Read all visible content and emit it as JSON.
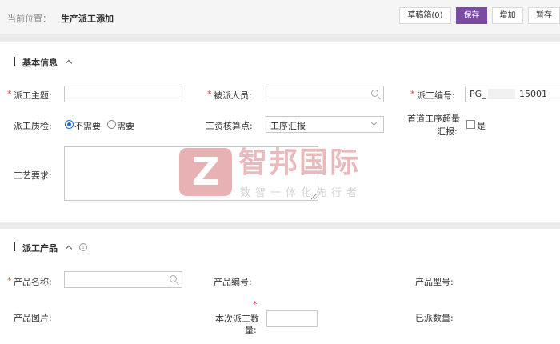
{
  "breadcrumb": {
    "label": "当前位置：",
    "page": "生产派工添加"
  },
  "toolbar": {
    "draft": "草稿箱(0)",
    "save": "保存",
    "add": "增加",
    "hold": "暂存"
  },
  "colors": {
    "accent": "#7b4aa3",
    "required": "#e4393c",
    "radio_selected": "#1f6fd0"
  },
  "basic": {
    "title": "基本信息",
    "subject_label": "派工主题:",
    "assignee_label": "被派人员:",
    "number_label": "派工编号:",
    "number_value_prefix": "PG_",
    "number_value_suffix": "15001",
    "qc_label": "派工质检:",
    "qc_opt_no": "不需要",
    "qc_opt_yes": "需要",
    "qc_selected": "不需要",
    "wage_label": "工资核算点:",
    "wage_value": "工序汇报",
    "first_over_label_1": "首道工序超量",
    "first_over_label_2": "汇报:",
    "first_over_check": "是",
    "craft_label": "工艺要求:"
  },
  "product": {
    "title": "派工产品",
    "name_label": "产品名称:",
    "code_label": "产品编号:",
    "model_label": "产品型号:",
    "image_label": "产品图片:",
    "qty_label_1": "本次派工数",
    "qty_label_2": "量:",
    "dispatched_label": "已派数量:"
  },
  "watermark": {
    "logo_letter": "Z",
    "name": "智邦国际",
    "slogan": "数智一体化先行者"
  }
}
